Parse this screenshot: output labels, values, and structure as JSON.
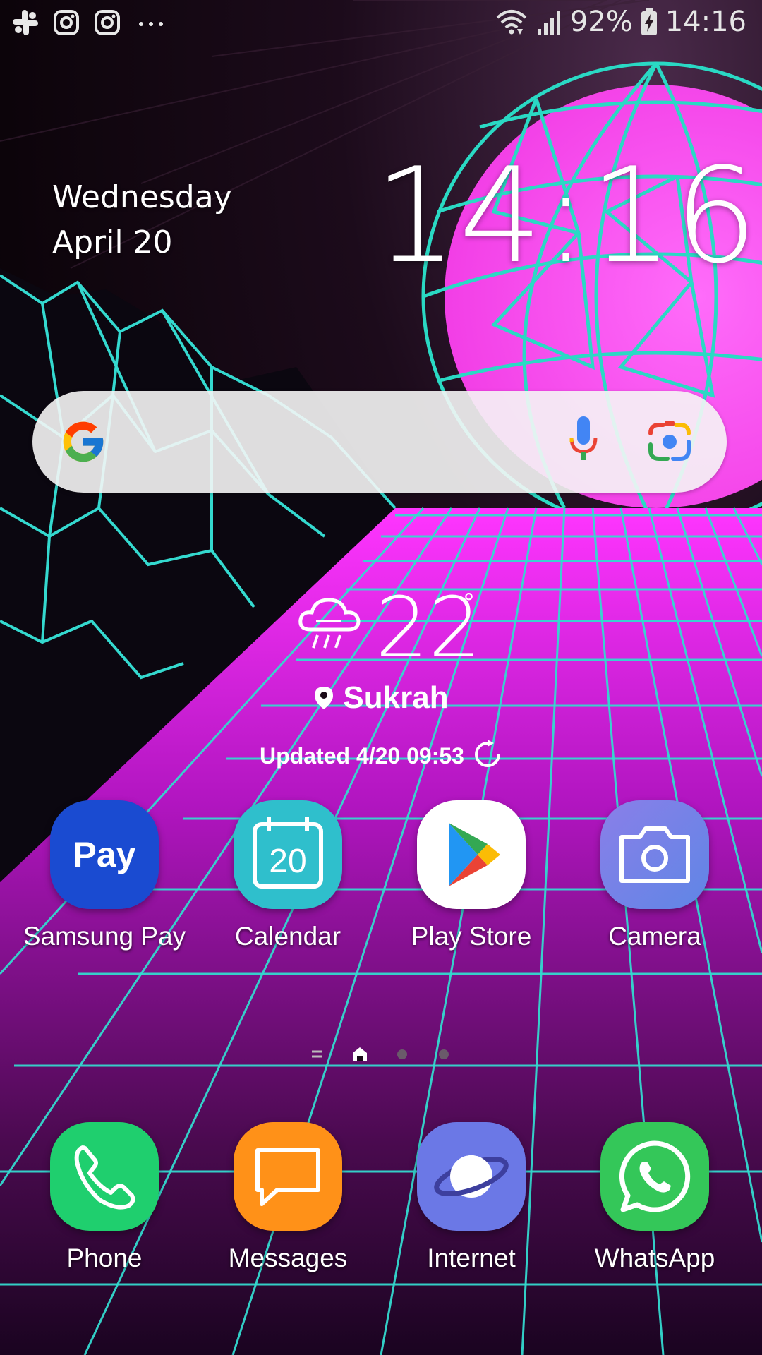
{
  "status_bar": {
    "notification_icons": [
      "slack-icon",
      "instagram-icon",
      "instagram-icon",
      "more-dots-icon"
    ],
    "battery_percent": "92%",
    "time": "14:16"
  },
  "clock_widget": {
    "day": "Wednesday",
    "date": "April 20",
    "time": "14:16"
  },
  "search_bar": {
    "logo": "google-g-icon",
    "voice_icon": "mic-icon",
    "lens_icon": "lens-icon"
  },
  "weather": {
    "icon": "rain-cloud-icon",
    "temperature": "22",
    "degree_symbol": "°",
    "location": "Sukrah",
    "updated": "Updated 4/20 09:53"
  },
  "apps": [
    {
      "label": "Samsung Pay",
      "icon": "samsung-pay-icon",
      "icon_text": "Pay",
      "color": "#1a4bd1"
    },
    {
      "label": "Calendar",
      "icon": "calendar-icon",
      "icon_text": "20",
      "color": "#2fbfcc"
    },
    {
      "label": "Play Store",
      "icon": "play-store-icon",
      "color": "#ffffff"
    },
    {
      "label": "Camera",
      "icon": "camera-icon",
      "color": "#7b7fe0"
    }
  ],
  "page_indicator": {
    "pages": [
      "menu",
      "home",
      "page",
      "page"
    ],
    "current": "home"
  },
  "dock": [
    {
      "label": "Phone",
      "icon": "phone-icon",
      "color": "#1fcf6e"
    },
    {
      "label": "Messages",
      "icon": "messages-icon",
      "color": "#ff9118"
    },
    {
      "label": "Internet",
      "icon": "internet-icon",
      "color": "#6b78e6"
    },
    {
      "label": "WhatsApp",
      "icon": "whatsapp-icon",
      "color": "#34c759"
    }
  ],
  "theme": {
    "wallpaper_sky": "#12060f",
    "grid_cyan": "#34d9cf",
    "grid_magenta": "#e61ce0",
    "sun_pink": "#ff4af0"
  }
}
